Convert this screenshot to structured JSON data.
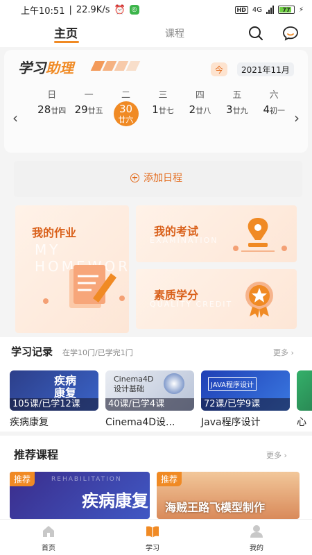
{
  "status_bar": {
    "time": "上午10:51",
    "speed": "22.9K/s",
    "battery": "77",
    "network": "4G"
  },
  "top_nav": {
    "tab_home": "主页",
    "tab_course": "课程"
  },
  "assistant": {
    "title_plain": "学习",
    "title_accent": "助理",
    "today_label": "今",
    "month_label": "2021年11月",
    "weekdays": [
      "日",
      "一",
      "二",
      "三",
      "四",
      "五",
      "六"
    ],
    "days": [
      {
        "num": "28",
        "lunar": "廿四"
      },
      {
        "num": "29",
        "lunar": "廿五"
      },
      {
        "num": "30",
        "lunar": "廿六"
      },
      {
        "num": "1",
        "lunar": "廿七"
      },
      {
        "num": "2",
        "lunar": "廿八"
      },
      {
        "num": "3",
        "lunar": "廿九"
      },
      {
        "num": "4",
        "lunar": "初一"
      }
    ],
    "selected_index": 2
  },
  "add_schedule": {
    "label": "添加日程"
  },
  "cards": {
    "homework": {
      "title": "我的作业",
      "watermark": "MY HOMEWORK"
    },
    "exam": {
      "title": "我的考试",
      "watermark": "EXAMINATION"
    },
    "credit": {
      "title": "素质学分",
      "watermark": "QUALITY CREDIT"
    }
  },
  "study_record": {
    "title": "学习记录",
    "subtitle": "在学10门/已学完1门",
    "more": "更多",
    "courses": [
      {
        "name": "疾病康复",
        "count": "105课/已学12课",
        "thumb_text": "疾病\n康复",
        "thumb_en": "REHABILITATION"
      },
      {
        "name": "Cinema4D设...",
        "count": "40课/已学4课",
        "thumb_text": "Cinema4D\n设计基础"
      },
      {
        "name": "Java程序设计",
        "count": "72课/已学9课",
        "thumb_text": "JAVA程序设计"
      }
    ],
    "partial_char": "心"
  },
  "recommend": {
    "title": "推荐课程",
    "more": "更多",
    "items": [
      {
        "tag": "推荐",
        "text": "疾病康复",
        "en": "REHABILITATION"
      },
      {
        "tag": "推荐",
        "text": "海贼王路飞模型制作"
      }
    ]
  },
  "bottom_nav": {
    "home": "首页",
    "study": "学习",
    "mine": "我的"
  },
  "colors": {
    "accent": "#f08a24",
    "accent_dark": "#e36a1b"
  }
}
